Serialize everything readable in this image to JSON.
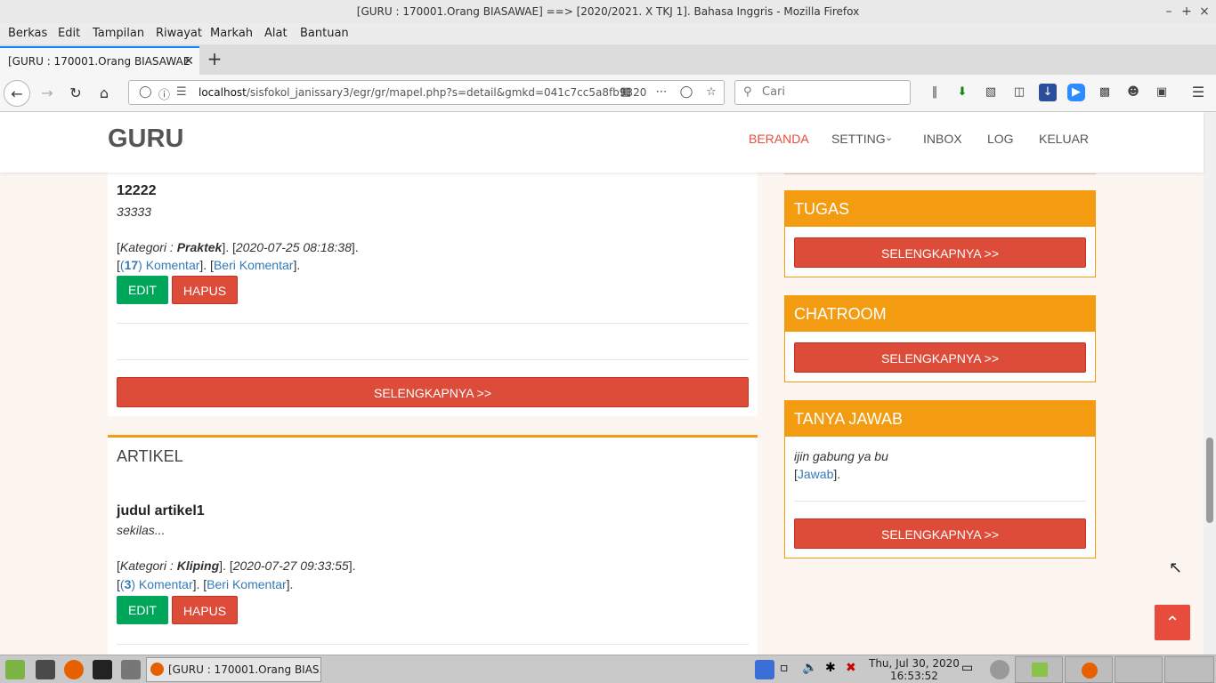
{
  "window": {
    "title": "[GURU : 170001.Orang BIASAWAE] ==> [2020/2021. X TKJ 1]. Bahasa Inggris - Mozilla Firefox"
  },
  "menu": [
    "Berkas",
    "Edit",
    "Tampilan",
    "Riwayat",
    "Markah",
    "Alat",
    "Bantuan"
  ],
  "tab": {
    "label": "[GURU : 170001.Orang BIASAWAE"
  },
  "address": {
    "host": "localhost",
    "path": "/sisfokol_janissary3/egr/gr/mapel.php?s=detail&gmkd=041c7cc5a8fb9320",
    "search_placeholder": "Cari"
  },
  "site": {
    "brand": "GURU",
    "nav": [
      "BERANDA",
      "SETTING",
      "INBOX",
      "LOG",
      "KELUAR"
    ]
  },
  "tugas_item": {
    "title": "12222",
    "subtitle": "33333",
    "kategori_prefix": "Kategori : ",
    "kategori": "Praktek",
    "datetime": "2020-07-25 08:18:38",
    "komentar_count": "17",
    "komentar_label": ") Komentar",
    "beri_komentar": "Beri Komentar"
  },
  "buttons": {
    "edit": "EDIT",
    "hapus": "HAPUS",
    "more": "SELENGKAPNYA >>"
  },
  "artikel": {
    "heading": "ARTIKEL",
    "title": "judul artikel1",
    "subtitle": "sekilas...",
    "kategori_prefix": "Kategori : ",
    "kategori": "Kliping",
    "datetime": "2020-07-27 09:33:55",
    "komentar_count": "3",
    "komentar_label": ") Komentar",
    "beri_komentar": "Beri Komentar"
  },
  "sidebar": {
    "tugas": "TUGAS",
    "chatroom": "CHATROOM",
    "tanya_jawab": "TANYA JAWAB",
    "tanya_text": "ijin gabung ya bu",
    "jawab_link": "Jawab"
  },
  "taskbar": {
    "task_label": "[GURU : 170001.Orang BIAS...",
    "date": "Thu, Jul 30, 2020",
    "time": "16:53:52"
  },
  "colors": {
    "accent_orange": "#f39c12",
    "accent_red": "#dd4b39",
    "accent_green": "#00a65a",
    "link_blue": "#337ab7"
  }
}
